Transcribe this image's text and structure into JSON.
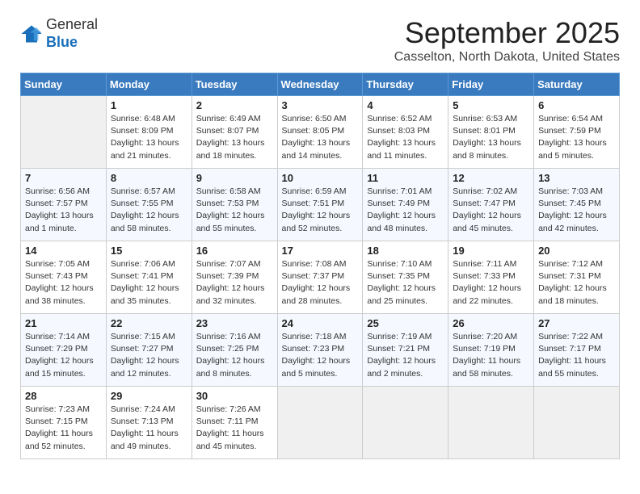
{
  "header": {
    "logo_line1": "General",
    "logo_line2": "Blue",
    "month": "September 2025",
    "location": "Casselton, North Dakota, United States"
  },
  "weekdays": [
    "Sunday",
    "Monday",
    "Tuesday",
    "Wednesday",
    "Thursday",
    "Friday",
    "Saturday"
  ],
  "weeks": [
    [
      {
        "day": "",
        "sunrise": "",
        "sunset": "",
        "daylight": ""
      },
      {
        "day": "1",
        "sunrise": "Sunrise: 6:48 AM",
        "sunset": "Sunset: 8:09 PM",
        "daylight": "Daylight: 13 hours and 21 minutes."
      },
      {
        "day": "2",
        "sunrise": "Sunrise: 6:49 AM",
        "sunset": "Sunset: 8:07 PM",
        "daylight": "Daylight: 13 hours and 18 minutes."
      },
      {
        "day": "3",
        "sunrise": "Sunrise: 6:50 AM",
        "sunset": "Sunset: 8:05 PM",
        "daylight": "Daylight: 13 hours and 14 minutes."
      },
      {
        "day": "4",
        "sunrise": "Sunrise: 6:52 AM",
        "sunset": "Sunset: 8:03 PM",
        "daylight": "Daylight: 13 hours and 11 minutes."
      },
      {
        "day": "5",
        "sunrise": "Sunrise: 6:53 AM",
        "sunset": "Sunset: 8:01 PM",
        "daylight": "Daylight: 13 hours and 8 minutes."
      },
      {
        "day": "6",
        "sunrise": "Sunrise: 6:54 AM",
        "sunset": "Sunset: 7:59 PM",
        "daylight": "Daylight: 13 hours and 5 minutes."
      }
    ],
    [
      {
        "day": "7",
        "sunrise": "Sunrise: 6:56 AM",
        "sunset": "Sunset: 7:57 PM",
        "daylight": "Daylight: 13 hours and 1 minute."
      },
      {
        "day": "8",
        "sunrise": "Sunrise: 6:57 AM",
        "sunset": "Sunset: 7:55 PM",
        "daylight": "Daylight: 12 hours and 58 minutes."
      },
      {
        "day": "9",
        "sunrise": "Sunrise: 6:58 AM",
        "sunset": "Sunset: 7:53 PM",
        "daylight": "Daylight: 12 hours and 55 minutes."
      },
      {
        "day": "10",
        "sunrise": "Sunrise: 6:59 AM",
        "sunset": "Sunset: 7:51 PM",
        "daylight": "Daylight: 12 hours and 52 minutes."
      },
      {
        "day": "11",
        "sunrise": "Sunrise: 7:01 AM",
        "sunset": "Sunset: 7:49 PM",
        "daylight": "Daylight: 12 hours and 48 minutes."
      },
      {
        "day": "12",
        "sunrise": "Sunrise: 7:02 AM",
        "sunset": "Sunset: 7:47 PM",
        "daylight": "Daylight: 12 hours and 45 minutes."
      },
      {
        "day": "13",
        "sunrise": "Sunrise: 7:03 AM",
        "sunset": "Sunset: 7:45 PM",
        "daylight": "Daylight: 12 hours and 42 minutes."
      }
    ],
    [
      {
        "day": "14",
        "sunrise": "Sunrise: 7:05 AM",
        "sunset": "Sunset: 7:43 PM",
        "daylight": "Daylight: 12 hours and 38 minutes."
      },
      {
        "day": "15",
        "sunrise": "Sunrise: 7:06 AM",
        "sunset": "Sunset: 7:41 PM",
        "daylight": "Daylight: 12 hours and 35 minutes."
      },
      {
        "day": "16",
        "sunrise": "Sunrise: 7:07 AM",
        "sunset": "Sunset: 7:39 PM",
        "daylight": "Daylight: 12 hours and 32 minutes."
      },
      {
        "day": "17",
        "sunrise": "Sunrise: 7:08 AM",
        "sunset": "Sunset: 7:37 PM",
        "daylight": "Daylight: 12 hours and 28 minutes."
      },
      {
        "day": "18",
        "sunrise": "Sunrise: 7:10 AM",
        "sunset": "Sunset: 7:35 PM",
        "daylight": "Daylight: 12 hours and 25 minutes."
      },
      {
        "day": "19",
        "sunrise": "Sunrise: 7:11 AM",
        "sunset": "Sunset: 7:33 PM",
        "daylight": "Daylight: 12 hours and 22 minutes."
      },
      {
        "day": "20",
        "sunrise": "Sunrise: 7:12 AM",
        "sunset": "Sunset: 7:31 PM",
        "daylight": "Daylight: 12 hours and 18 minutes."
      }
    ],
    [
      {
        "day": "21",
        "sunrise": "Sunrise: 7:14 AM",
        "sunset": "Sunset: 7:29 PM",
        "daylight": "Daylight: 12 hours and 15 minutes."
      },
      {
        "day": "22",
        "sunrise": "Sunrise: 7:15 AM",
        "sunset": "Sunset: 7:27 PM",
        "daylight": "Daylight: 12 hours and 12 minutes."
      },
      {
        "day": "23",
        "sunrise": "Sunrise: 7:16 AM",
        "sunset": "Sunset: 7:25 PM",
        "daylight": "Daylight: 12 hours and 8 minutes."
      },
      {
        "day": "24",
        "sunrise": "Sunrise: 7:18 AM",
        "sunset": "Sunset: 7:23 PM",
        "daylight": "Daylight: 12 hours and 5 minutes."
      },
      {
        "day": "25",
        "sunrise": "Sunrise: 7:19 AM",
        "sunset": "Sunset: 7:21 PM",
        "daylight": "Daylight: 12 hours and 2 minutes."
      },
      {
        "day": "26",
        "sunrise": "Sunrise: 7:20 AM",
        "sunset": "Sunset: 7:19 PM",
        "daylight": "Daylight: 11 hours and 58 minutes."
      },
      {
        "day": "27",
        "sunrise": "Sunrise: 7:22 AM",
        "sunset": "Sunset: 7:17 PM",
        "daylight": "Daylight: 11 hours and 55 minutes."
      }
    ],
    [
      {
        "day": "28",
        "sunrise": "Sunrise: 7:23 AM",
        "sunset": "Sunset: 7:15 PM",
        "daylight": "Daylight: 11 hours and 52 minutes."
      },
      {
        "day": "29",
        "sunrise": "Sunrise: 7:24 AM",
        "sunset": "Sunset: 7:13 PM",
        "daylight": "Daylight: 11 hours and 49 minutes."
      },
      {
        "day": "30",
        "sunrise": "Sunrise: 7:26 AM",
        "sunset": "Sunset: 7:11 PM",
        "daylight": "Daylight: 11 hours and 45 minutes."
      },
      {
        "day": "",
        "sunrise": "",
        "sunset": "",
        "daylight": ""
      },
      {
        "day": "",
        "sunrise": "",
        "sunset": "",
        "daylight": ""
      },
      {
        "day": "",
        "sunrise": "",
        "sunset": "",
        "daylight": ""
      },
      {
        "day": "",
        "sunrise": "",
        "sunset": "",
        "daylight": ""
      }
    ]
  ]
}
